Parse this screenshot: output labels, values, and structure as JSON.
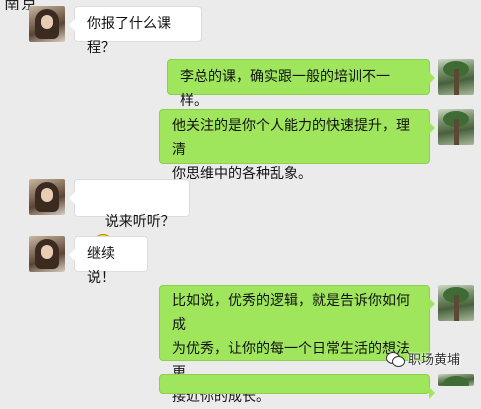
{
  "header": {
    "title": "南京"
  },
  "messages": [
    {
      "side": "left",
      "text": "你报了什么课程？"
    },
    {
      "side": "right",
      "text": "李总的课，确实跟一般的培训不一样。"
    },
    {
      "side": "right",
      "text": "他关注的是你个人能力的快速提升，理清\n你思维中的各种乱象。"
    },
    {
      "side": "left",
      "text": "说来听听？",
      "emoji": "smiling-face-emoji"
    },
    {
      "side": "left",
      "text": "继续说！"
    },
    {
      "side": "right",
      "text": "比如说，优秀的逻辑，就是告诉你如何成\n为优秀，让你的每一个日常生活的想法更\n接近你的成长。"
    }
  ],
  "watermark": {
    "text": "职场黄埔",
    "icon": "wechat-icon"
  },
  "colors": {
    "background": "#ebebeb",
    "right_bubble": "#9fe65c",
    "left_bubble": "#ffffff"
  }
}
